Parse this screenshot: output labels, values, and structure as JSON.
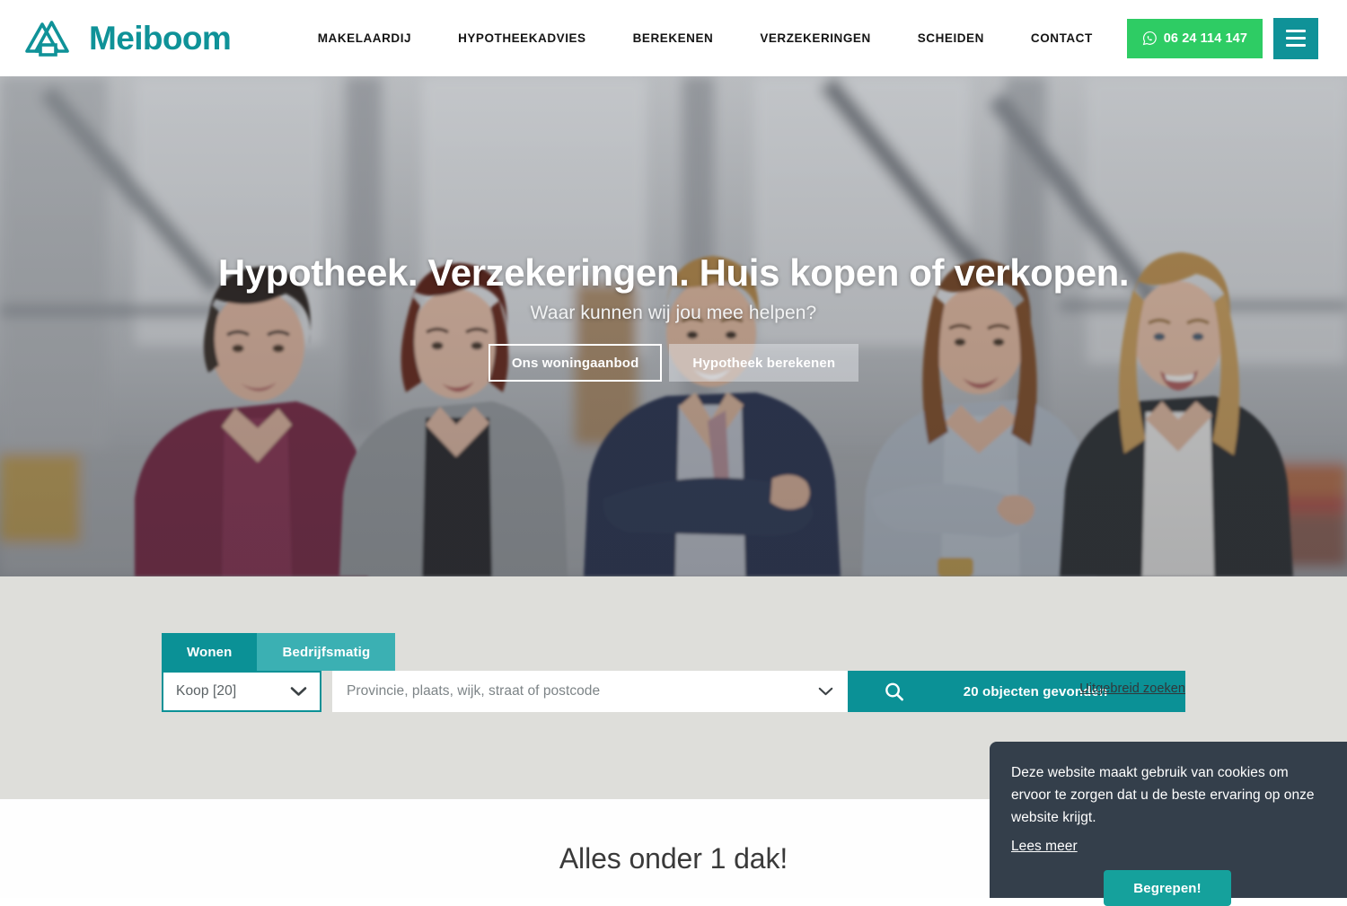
{
  "brand": {
    "name": "Meiboom",
    "accent_teal": "#0f9298",
    "whatsapp_green": "#2ecc64",
    "logo_icon": "mountains-house-logo-icon"
  },
  "header": {
    "nav_items": [
      {
        "label": "MAKELAARDIJ"
      },
      {
        "label": "HYPOTHEEKADVIES"
      },
      {
        "label": "BEREKENEN"
      },
      {
        "label": "VERZEKERINGEN"
      },
      {
        "label": "SCHEIDEN"
      },
      {
        "label": "CONTACT"
      }
    ],
    "whatsapp": {
      "phone": "06 24 114 147",
      "icon": "whatsapp-icon"
    },
    "menu_toggle_icon": "hamburger-menu-icon"
  },
  "hero": {
    "title": "Hypotheek. Verzekeringen. Huis kopen of verkopen.",
    "subtitle": "Waar kunnen wij jou mee helpen?",
    "primary_button": "Ons woningaanbod",
    "secondary_button": "Hypotheek berekenen",
    "image_alt": "Team van vijf medewerkers in een industriële ruimte"
  },
  "search": {
    "tabs": [
      {
        "label": "Wonen",
        "active": true
      },
      {
        "label": "Bedrijfsmatig",
        "active": false
      }
    ],
    "type_select": {
      "value": "Koop [20]",
      "icon": "chevron-down-icon"
    },
    "location_input": {
      "value": "",
      "placeholder": "Provincie, plaats, wijk, straat of postcode",
      "icon": "chevron-down-icon"
    },
    "submit": {
      "label": "20 objecten gevonden",
      "icon": "search-icon"
    },
    "advanced_link": "Uitgebreid zoeken"
  },
  "below_section": {
    "title": "Alles onder 1 dak!"
  },
  "cookie_banner": {
    "message": "Deze website maakt gebruik van cookies om ervoor te zorgen dat u de beste ervaring op onze website krijgt.",
    "read_more": "Lees meer",
    "accept_button": "Begrepen!",
    "background": "#343f4b",
    "accept_color": "#15a19c"
  }
}
